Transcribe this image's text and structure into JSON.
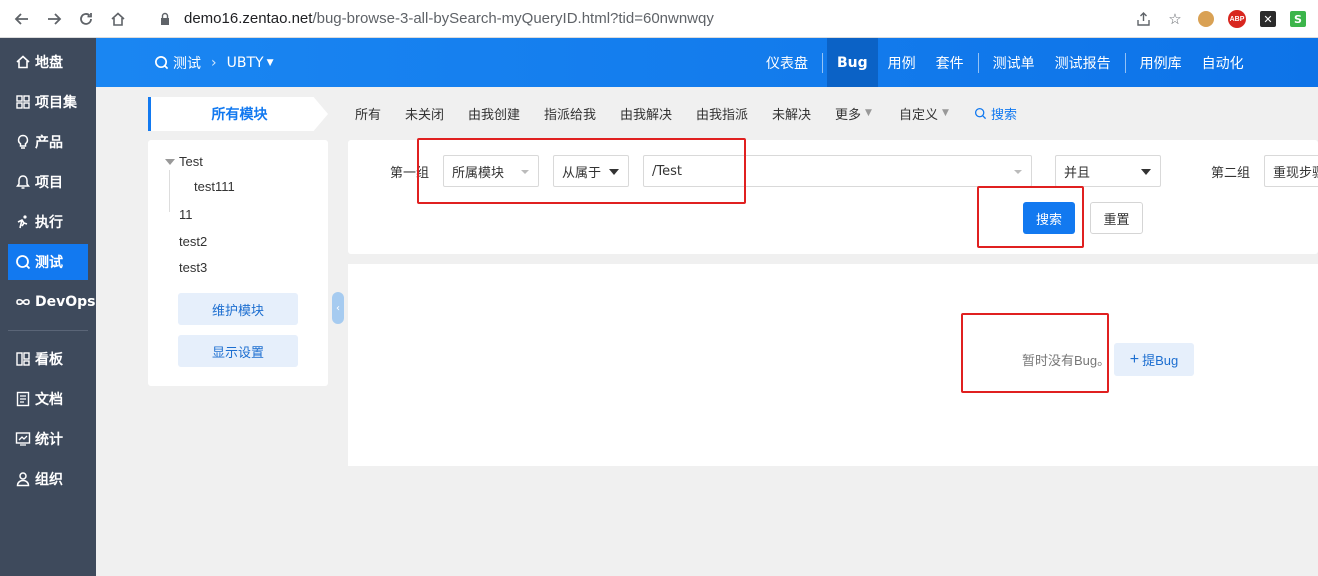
{
  "browser": {
    "url_host": "demo16.zentao.net",
    "url_path": "/bug-browse-3-all-bySearch-myQueryID.html?tid=60nwnwqy"
  },
  "sidebar": {
    "items": [
      {
        "label": "地盘",
        "icon": "home-icon"
      },
      {
        "label": "项目集",
        "icon": "grid-icon"
      },
      {
        "label": "产品",
        "icon": "lightbulb-icon"
      },
      {
        "label": "项目",
        "icon": "bell-icon"
      },
      {
        "label": "执行",
        "icon": "run-icon"
      },
      {
        "label": "测试",
        "icon": "search-icon",
        "active": true
      },
      {
        "label": "DevOps",
        "icon": "infinity-icon"
      },
      {
        "label": "看板",
        "icon": "kanban-icon"
      },
      {
        "label": "文档",
        "icon": "document-icon"
      },
      {
        "label": "统计",
        "icon": "chart-icon"
      },
      {
        "label": "组织",
        "icon": "user-icon"
      }
    ]
  },
  "header": {
    "breadcrumb": {
      "section": "测试",
      "product": "UBTY"
    },
    "nav": [
      "仪表盘",
      "Bug",
      "用例",
      "套件",
      "测试单",
      "测试报告",
      "用例库",
      "自动化"
    ],
    "active_nav": "Bug"
  },
  "module_tree": {
    "title": "所有模块",
    "nodes": [
      "Test",
      "test111",
      "11",
      "test2",
      "test3"
    ],
    "buttons": {
      "maintain": "维护模块",
      "display": "显示设置"
    }
  },
  "filter_tabs": [
    "所有",
    "未关闭",
    "由我创建",
    "指派给我",
    "由我解决",
    "由我指派",
    "未解决",
    "更多",
    "自定义",
    "搜索"
  ],
  "search": {
    "group1_label": "第一组",
    "field": "所属模块",
    "operator": "从属于",
    "value": "/Test",
    "logic": "并且",
    "group2_label": "第二组",
    "group2_field": "重现步骤",
    "search_button": "搜索",
    "reset_button": "重置"
  },
  "results": {
    "empty_text": "暂时没有Bug。",
    "add_bug": "提Bug"
  },
  "colors": {
    "primary": "#1279f0",
    "sidebar_bg": "#3e4a5c",
    "annotation_red": "#e02020"
  }
}
